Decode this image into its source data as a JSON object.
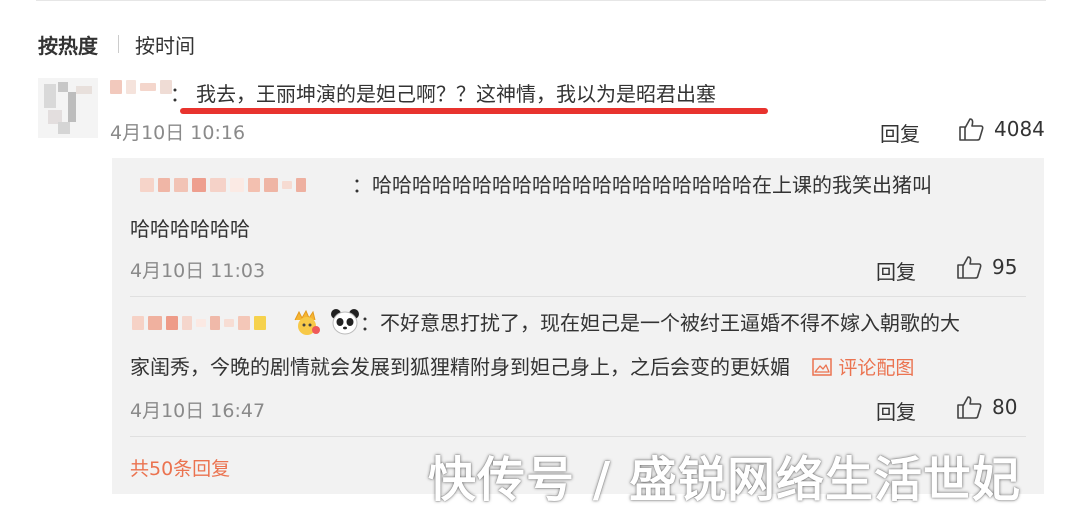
{
  "sort": {
    "hot_label": "按热度",
    "time_label": "按时间"
  },
  "main_comment": {
    "colon": "：",
    "text": "我去，王丽坤演的是妲己啊？？这神情，我以为是昭君出塞",
    "date": "4月10日 10:16",
    "reply_label": "回复",
    "likes": "4084"
  },
  "replies": [
    {
      "colon": "：",
      "text_line1": "哈哈哈哈哈哈哈哈哈哈哈哈哈哈哈哈哈哈哈在上课的我笑出猪叫",
      "text_line2": "哈哈哈哈哈哈",
      "date": "4月10日 11:03",
      "reply_label": "回复",
      "likes": "95"
    },
    {
      "colon": "：",
      "text_line1": "不好意思打扰了，现在妲己是一个被纣王逼婚不得不嫁入朝歌的大",
      "text_line2": "家闺秀，今晚的剧情就会发展到狐狸精附身到妲己身上，之后会变的更妖媚",
      "pic_link": "评论配图",
      "date": "4月10日 16:47",
      "reply_label": "回复",
      "likes": "80"
    }
  ],
  "more_replies": "共50条回复",
  "watermark": "快传号 / 盛锐网络生活世妃",
  "colors": {
    "accent_red": "#e8332e",
    "link_orange": "#eb7350",
    "reply_bg": "#f2f2f2"
  }
}
